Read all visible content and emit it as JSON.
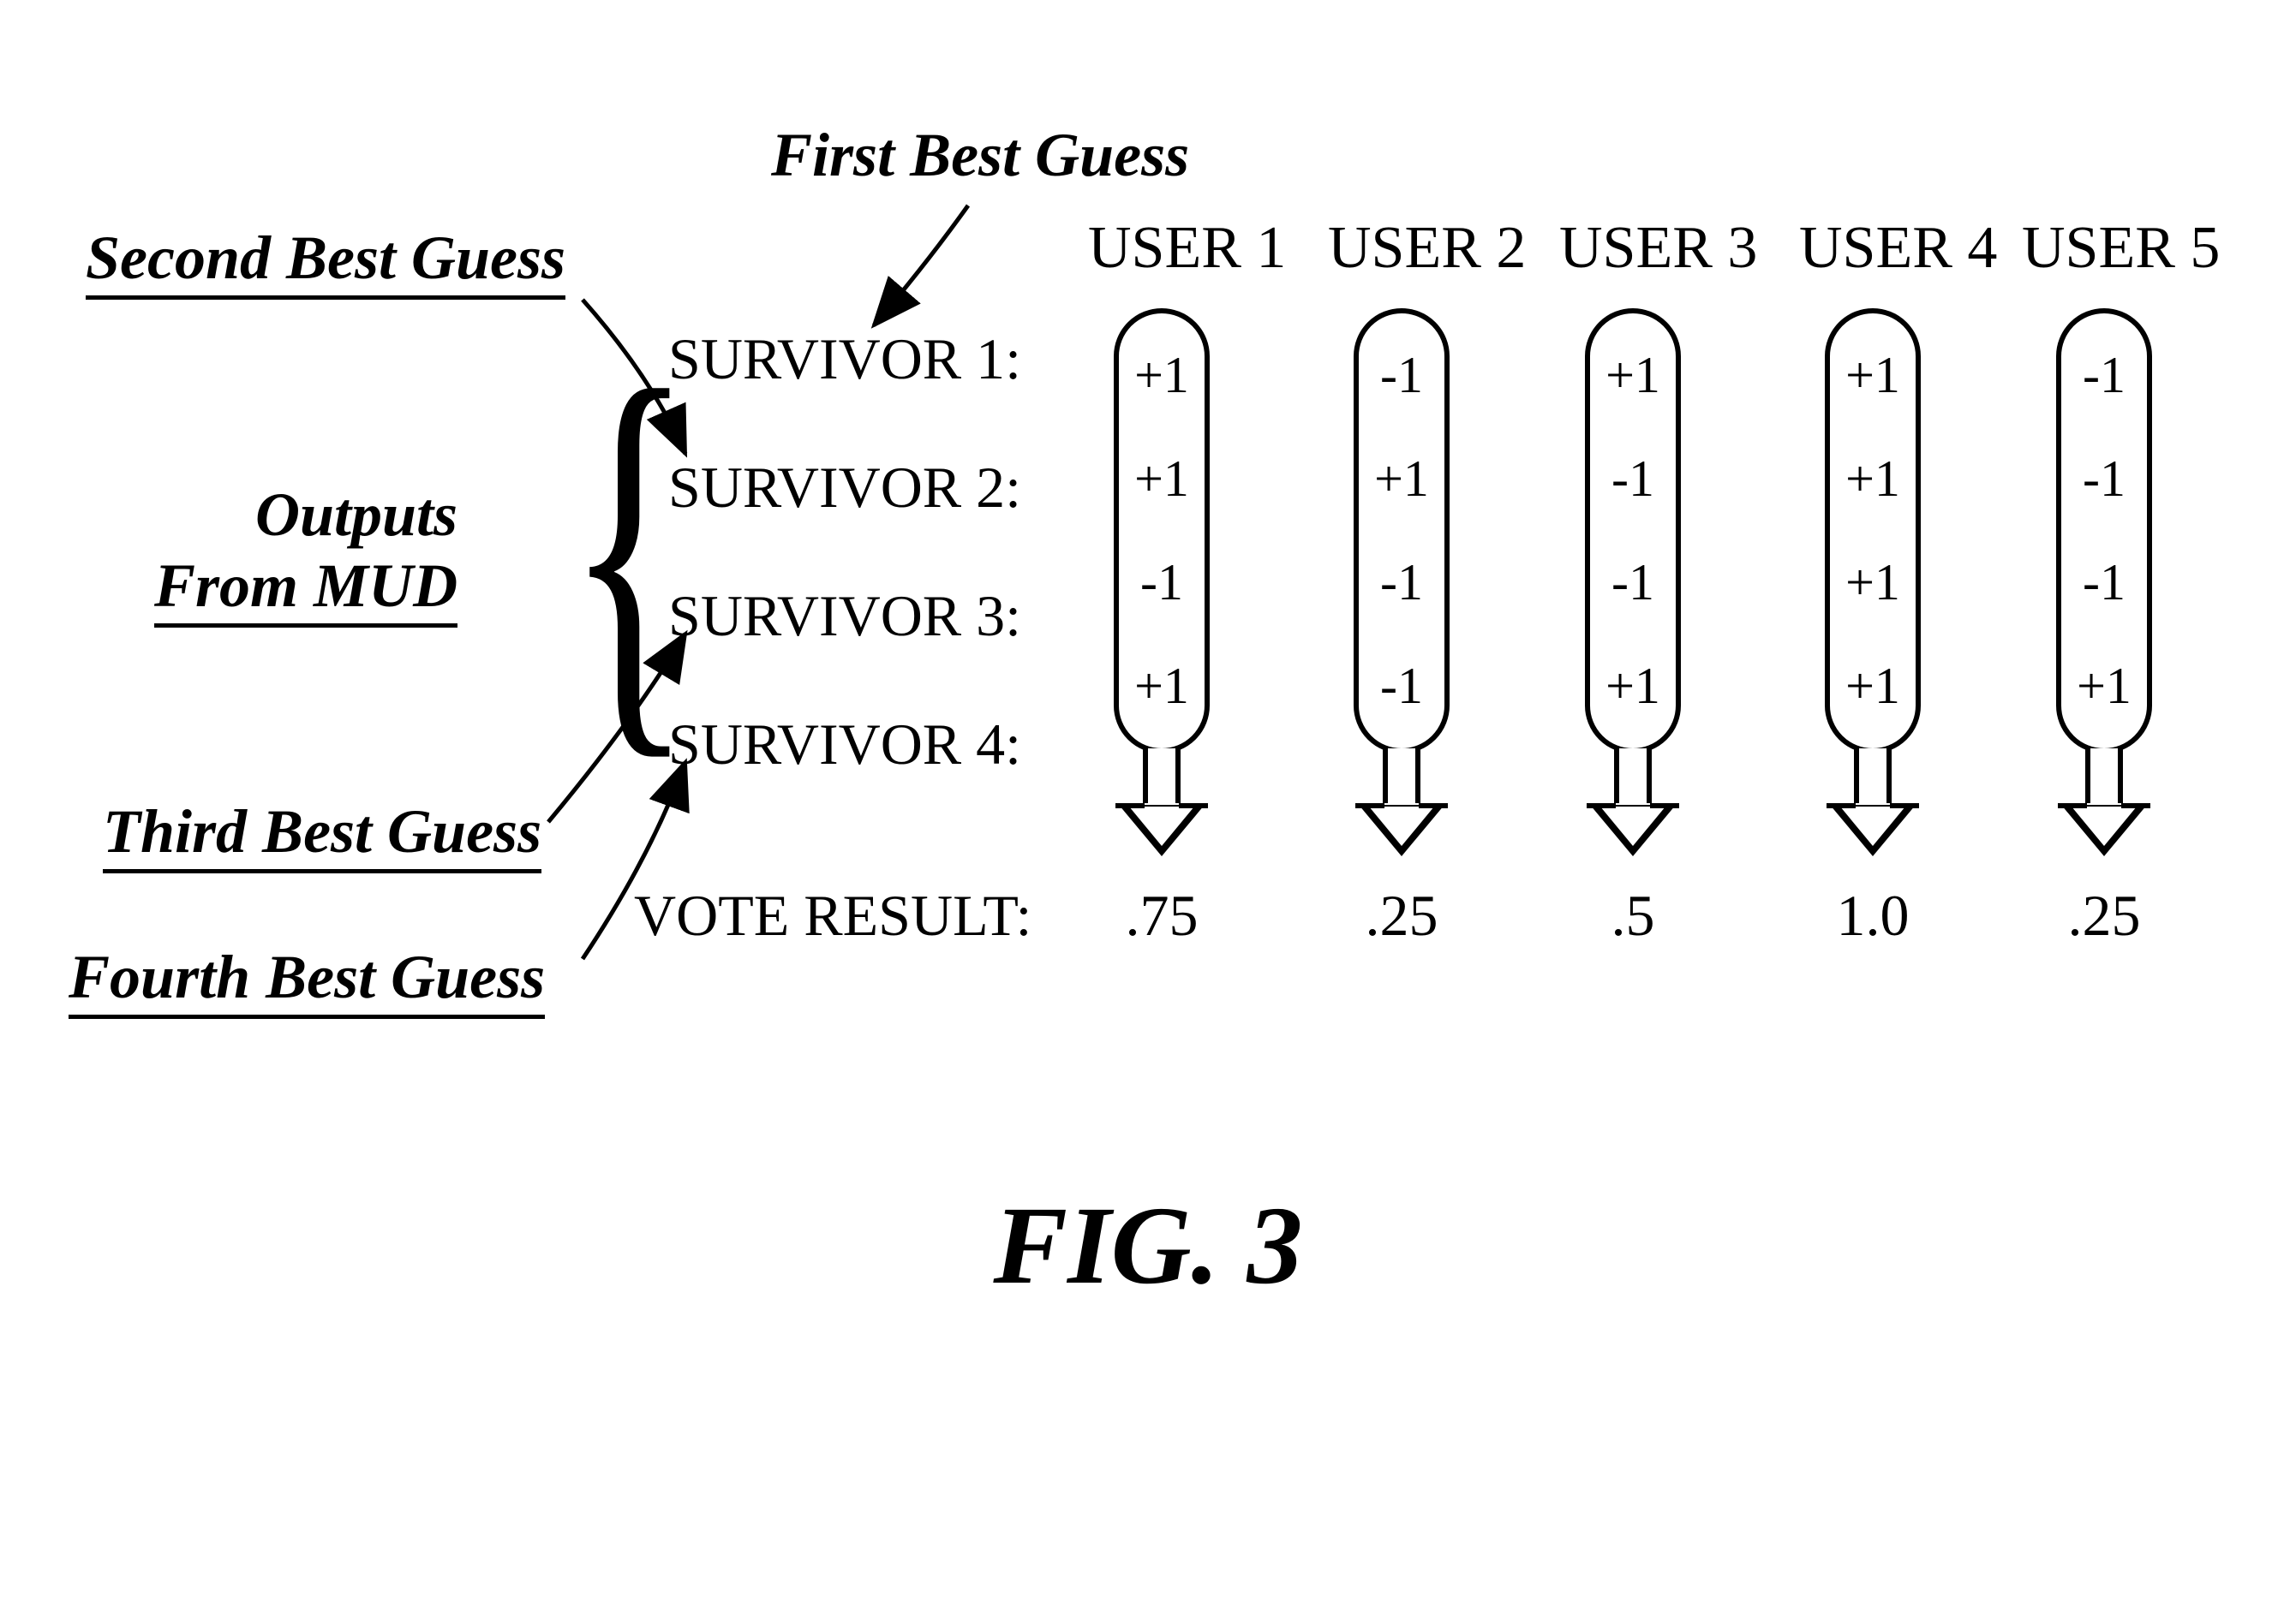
{
  "title_first": "First Best Guess",
  "title_second": "Second Best Guess",
  "title_third": "Third Best Guess",
  "title_fourth": "Fourth Best Guess",
  "outputs_line1": "Outputs",
  "outputs_line2": "From MUD",
  "users": [
    "USER 1",
    "USER 2",
    "USER 3",
    "USER 4",
    "USER 5"
  ],
  "survivors": [
    "SURVIVOR 1:",
    "SURVIVOR 2:",
    "SURVIVOR 3:",
    "SURVIVOR 4:"
  ],
  "vote_label": "VOTE RESULT:",
  "chart_data": {
    "type": "table",
    "title": "FIG. 3",
    "columns": [
      "USER 1",
      "USER 2",
      "USER 3",
      "USER 4",
      "USER 5"
    ],
    "rows": [
      "SURVIVOR 1",
      "SURVIVOR 2",
      "SURVIVOR 3",
      "SURVIVOR 4"
    ],
    "values": [
      [
        "+1",
        "-1",
        "+1",
        "+1",
        "-1"
      ],
      [
        "+1",
        "+1",
        "-1",
        "+1",
        "-1"
      ],
      [
        "-1",
        "-1",
        "-1",
        "+1",
        "-1"
      ],
      [
        "+1",
        "-1",
        "+1",
        "+1",
        "+1"
      ]
    ],
    "vote_result": [
      ".75",
      ".25",
      ".5",
      "1.0",
      ".25"
    ]
  },
  "figure_caption": "FIG. 3"
}
